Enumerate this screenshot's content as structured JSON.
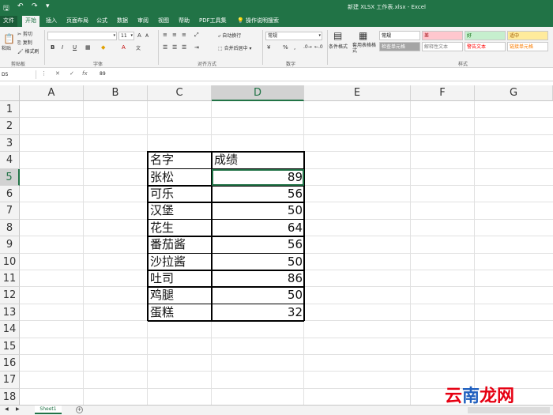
{
  "window": {
    "title": "新建 XLSX 工作表.xlsx - Excel"
  },
  "tabs": [
    "文件",
    "开始",
    "插入",
    "页面布局",
    "公式",
    "数据",
    "审阅",
    "视图",
    "帮助",
    "PDF工具集",
    "操作说明搜索"
  ],
  "ribbon": {
    "clipboard": {
      "cut": "剪切",
      "copy": "复制",
      "paste": "粘贴",
      "format_painter": "格式刷",
      "label": "剪贴板"
    },
    "font": {
      "size": "11",
      "label": "字体",
      "bold": "B",
      "italic": "I",
      "underline": "U"
    },
    "alignment": {
      "wrap": "自动换行",
      "merge": "合并后居中",
      "label": "对齐方式"
    },
    "number": {
      "format": "常规",
      "percent": "%",
      "comma": ",",
      "label": "数字"
    },
    "styles": {
      "conditional": "条件格式",
      "table": "套用表格格式",
      "cells": [
        {
          "text": "常规",
          "bg": "#ffffff",
          "fg": "#000000"
        },
        {
          "text": "差",
          "bg": "#ffc7ce",
          "fg": "#9c0006"
        },
        {
          "text": "好",
          "bg": "#c6efce",
          "fg": "#006100"
        },
        {
          "text": "适中",
          "bg": "#ffeb9c",
          "fg": "#9c5700"
        },
        {
          "text": "检查单元格",
          "bg": "#a5a5a5",
          "fg": "#ffffff"
        },
        {
          "text": "解释性文本",
          "bg": "#ffffff",
          "fg": "#7f7f7f"
        },
        {
          "text": "警告文本",
          "bg": "#ffffff",
          "fg": "#ff0000"
        },
        {
          "text": "链接单元格",
          "bg": "#ffffff",
          "fg": "#fa7d00"
        }
      ],
      "label": "样式"
    }
  },
  "formula_bar": {
    "name_box": "D5",
    "content": "89"
  },
  "columns": [
    "A",
    "B",
    "C",
    "D",
    "E",
    "F",
    "G"
  ],
  "rows": [
    "1",
    "2",
    "3",
    "4",
    "5",
    "6",
    "7",
    "8",
    "9",
    "10",
    "11",
    "12",
    "13",
    "14",
    "15",
    "16",
    "17",
    "18"
  ],
  "table": {
    "headers": [
      "名字",
      "成绩"
    ],
    "rows": [
      {
        "name": "张松",
        "score": "89"
      },
      {
        "name": "可乐",
        "score": "56"
      },
      {
        "name": "汉堡",
        "score": "50"
      },
      {
        "name": "花生",
        "score": "64"
      },
      {
        "name": "番茄酱",
        "score": "56"
      },
      {
        "name": "沙拉酱",
        "score": "50"
      },
      {
        "name": "吐司",
        "score": "86"
      },
      {
        "name": "鸡腿",
        "score": "50"
      },
      {
        "name": "蛋糕",
        "score": "32"
      }
    ]
  },
  "sheet_tabs": [
    "Sheet1"
  ],
  "watermark": "云南龙网",
  "colors": {
    "accent": "#217346",
    "watermark_red": "#e60012",
    "watermark_blue": "#1f5fbf"
  }
}
